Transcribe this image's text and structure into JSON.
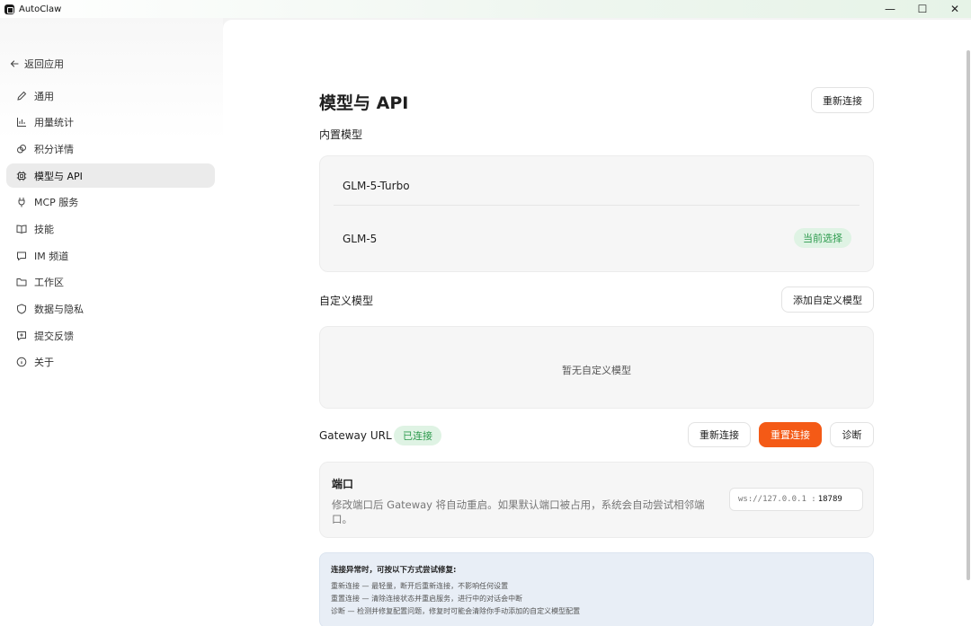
{
  "window": {
    "title": "AutoClaw",
    "min_glyph": "—",
    "max_glyph": "☐",
    "close_glyph": "✕"
  },
  "sidebar": {
    "back_label": "返回应用",
    "items": [
      {
        "label": "通用",
        "icon": "pencil-icon"
      },
      {
        "label": "用量统计",
        "icon": "bar-chart-icon"
      },
      {
        "label": "积分详情",
        "icon": "coins-icon"
      },
      {
        "label": "模型与 API",
        "icon": "chip-icon"
      },
      {
        "label": "MCP 服务",
        "icon": "plug-icon"
      },
      {
        "label": "技能",
        "icon": "book-icon"
      },
      {
        "label": "IM 频道",
        "icon": "chat-icon"
      },
      {
        "label": "工作区",
        "icon": "folder-icon"
      },
      {
        "label": "数据与隐私",
        "icon": "shield-icon"
      },
      {
        "label": "提交反馈",
        "icon": "feedback-icon"
      },
      {
        "label": "关于",
        "icon": "info-icon"
      }
    ],
    "active_index": 3
  },
  "main": {
    "title": "模型与 API",
    "reconnect_top_label": "重新连接",
    "builtin": {
      "label": "内置模型",
      "models": [
        {
          "name": "GLM-5-Turbo",
          "badge": ""
        },
        {
          "name": "GLM-5",
          "badge": "当前选择"
        }
      ]
    },
    "custom": {
      "label": "自定义模型",
      "add_label": "添加自定义模型",
      "empty_text": "暂无自定义模型"
    },
    "gateway": {
      "label": "Gateway URL",
      "status": "已连接",
      "reconnect_label": "重新连接",
      "reset_label": "重置连接",
      "diagnose_label": "诊断"
    },
    "port": {
      "title": "端口",
      "description": "修改端口后 Gateway 将自动重启。如果默认端口被占用，系统会自动尝试相邻端口。",
      "prefix": "ws://127.0.0.1 :",
      "value": "18789"
    },
    "help": {
      "title": "连接异常时，可按以下方式尝试修复:",
      "lines": [
        "重新连接 — 最轻量，断开后重新连接，不影响任何设置",
        "重置连接 — 清除连接状态并重启服务，进行中的对话会中断",
        "诊断 — 检测并修复配置问题，修复时可能会清除你手动添加的自定义模型配置"
      ]
    }
  },
  "colors": {
    "accent": "#f45a16",
    "success": "#2e9b4e",
    "success_bg": "#dff3e4"
  }
}
